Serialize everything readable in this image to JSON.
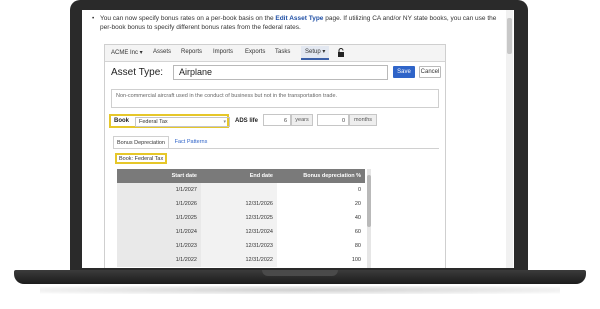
{
  "bullet": {
    "dot": "•",
    "text_before": "You can now specify bonus rates on a per-book basis on the ",
    "link_text": "Edit Asset Type",
    "text_after": " page. If utilizing CA and/or NY state books, you can use the per-book bonus to specify different bonus rates from the federal rates."
  },
  "navbar": {
    "items": [
      "ACME Inc ▾",
      "Assets",
      "Reports",
      "Imports",
      "Exports",
      "Tasks"
    ],
    "setup": "Setup ▾"
  },
  "form": {
    "title_label": "Asset Type:",
    "title_value": "Airplane",
    "save_label": "Save",
    "cancel_label": "Cancel",
    "description": "Non-commercial aircraft used in the conduct of business but not in the transportation trade.",
    "book_label": "Book",
    "book_value": "Federal Tax",
    "ads_label": "ADS life",
    "ads_years_value": "6",
    "ads_years_unit": "years",
    "ads_months_value": "0",
    "ads_months_unit": "months"
  },
  "tabs": [
    "Bonus Depreciation",
    "Fact Patterns"
  ],
  "book_caption": "Book: Federal Tax",
  "table": {
    "headers": [
      "Start date",
      "End date",
      "Bonus depreciation %"
    ],
    "rows": [
      [
        "1/1/2027",
        "",
        "0"
      ],
      [
        "1/1/2026",
        "12/31/2026",
        "20"
      ],
      [
        "1/1/2025",
        "12/31/2025",
        "40"
      ],
      [
        "1/1/2024",
        "12/31/2024",
        "60"
      ],
      [
        "1/1/2023",
        "12/31/2023",
        "80"
      ],
      [
        "1/1/2022",
        "12/31/2022",
        "100"
      ]
    ]
  },
  "colors": {
    "accent": "#2f64c8",
    "highlight": "#e6c72a",
    "link": "#1f4fa5"
  }
}
